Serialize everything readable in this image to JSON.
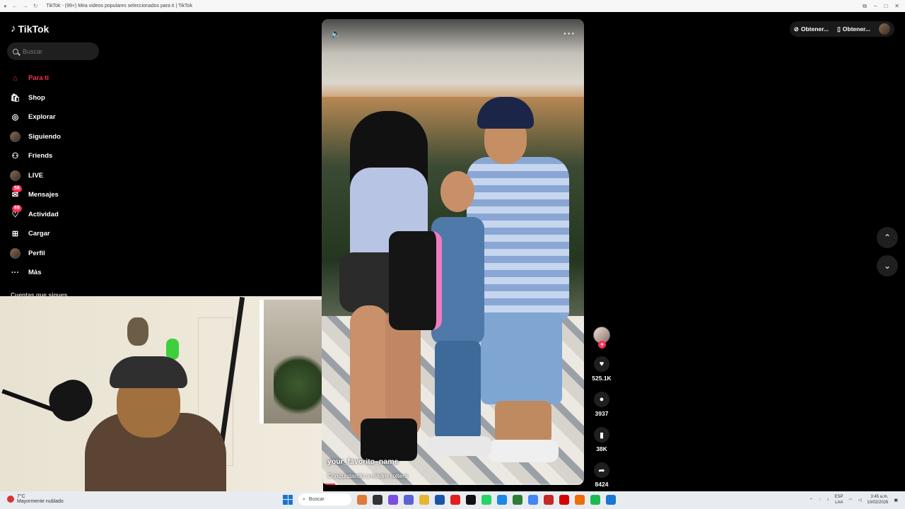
{
  "browser": {
    "tab_title": "TikTok - (99+) Mira videos populares seleccionados para ti | TikTok"
  },
  "sidebar": {
    "logo_text": "TikTok",
    "search_placeholder": "Buscar",
    "items": [
      {
        "label": "Para ti",
        "icon": "home-icon"
      },
      {
        "label": "Shop",
        "icon": "shop-icon"
      },
      {
        "label": "Explorar",
        "icon": "compass-icon"
      },
      {
        "label": "Siguiendo",
        "icon": "avatar"
      },
      {
        "label": "Friends",
        "icon": "friends-icon"
      },
      {
        "label": "LIVE",
        "icon": "avatar"
      },
      {
        "label": "Mensajes",
        "icon": "messages-icon",
        "badge": "58"
      },
      {
        "label": "Actividad",
        "icon": "activity-icon",
        "badge": "69"
      },
      {
        "label": "Cargar",
        "icon": "upload-icon"
      },
      {
        "label": "Perfil",
        "icon": "avatar"
      },
      {
        "label": "Más",
        "icon": "more-icon"
      }
    ],
    "following_title": "Cuentas que sigues"
  },
  "header": {
    "get_app_1": "Obtener...",
    "get_app_2": "Obtener..."
  },
  "video": {
    "author": "your_favorito_name",
    "description": "Conquistando a madre soltera",
    "progress": 0.05
  },
  "actions": {
    "likes": "525.1K",
    "comments": "3937",
    "saves": "38K",
    "shares": "8424"
  },
  "taskbar": {
    "weather_temp": "7°C",
    "weather_desc": "Mayormente nublado",
    "search_placeholder": "Buscar",
    "lang_1": "ESP",
    "lang_2": "LAA",
    "time": "3:45 a.m.",
    "date": "10/02/2026"
  }
}
